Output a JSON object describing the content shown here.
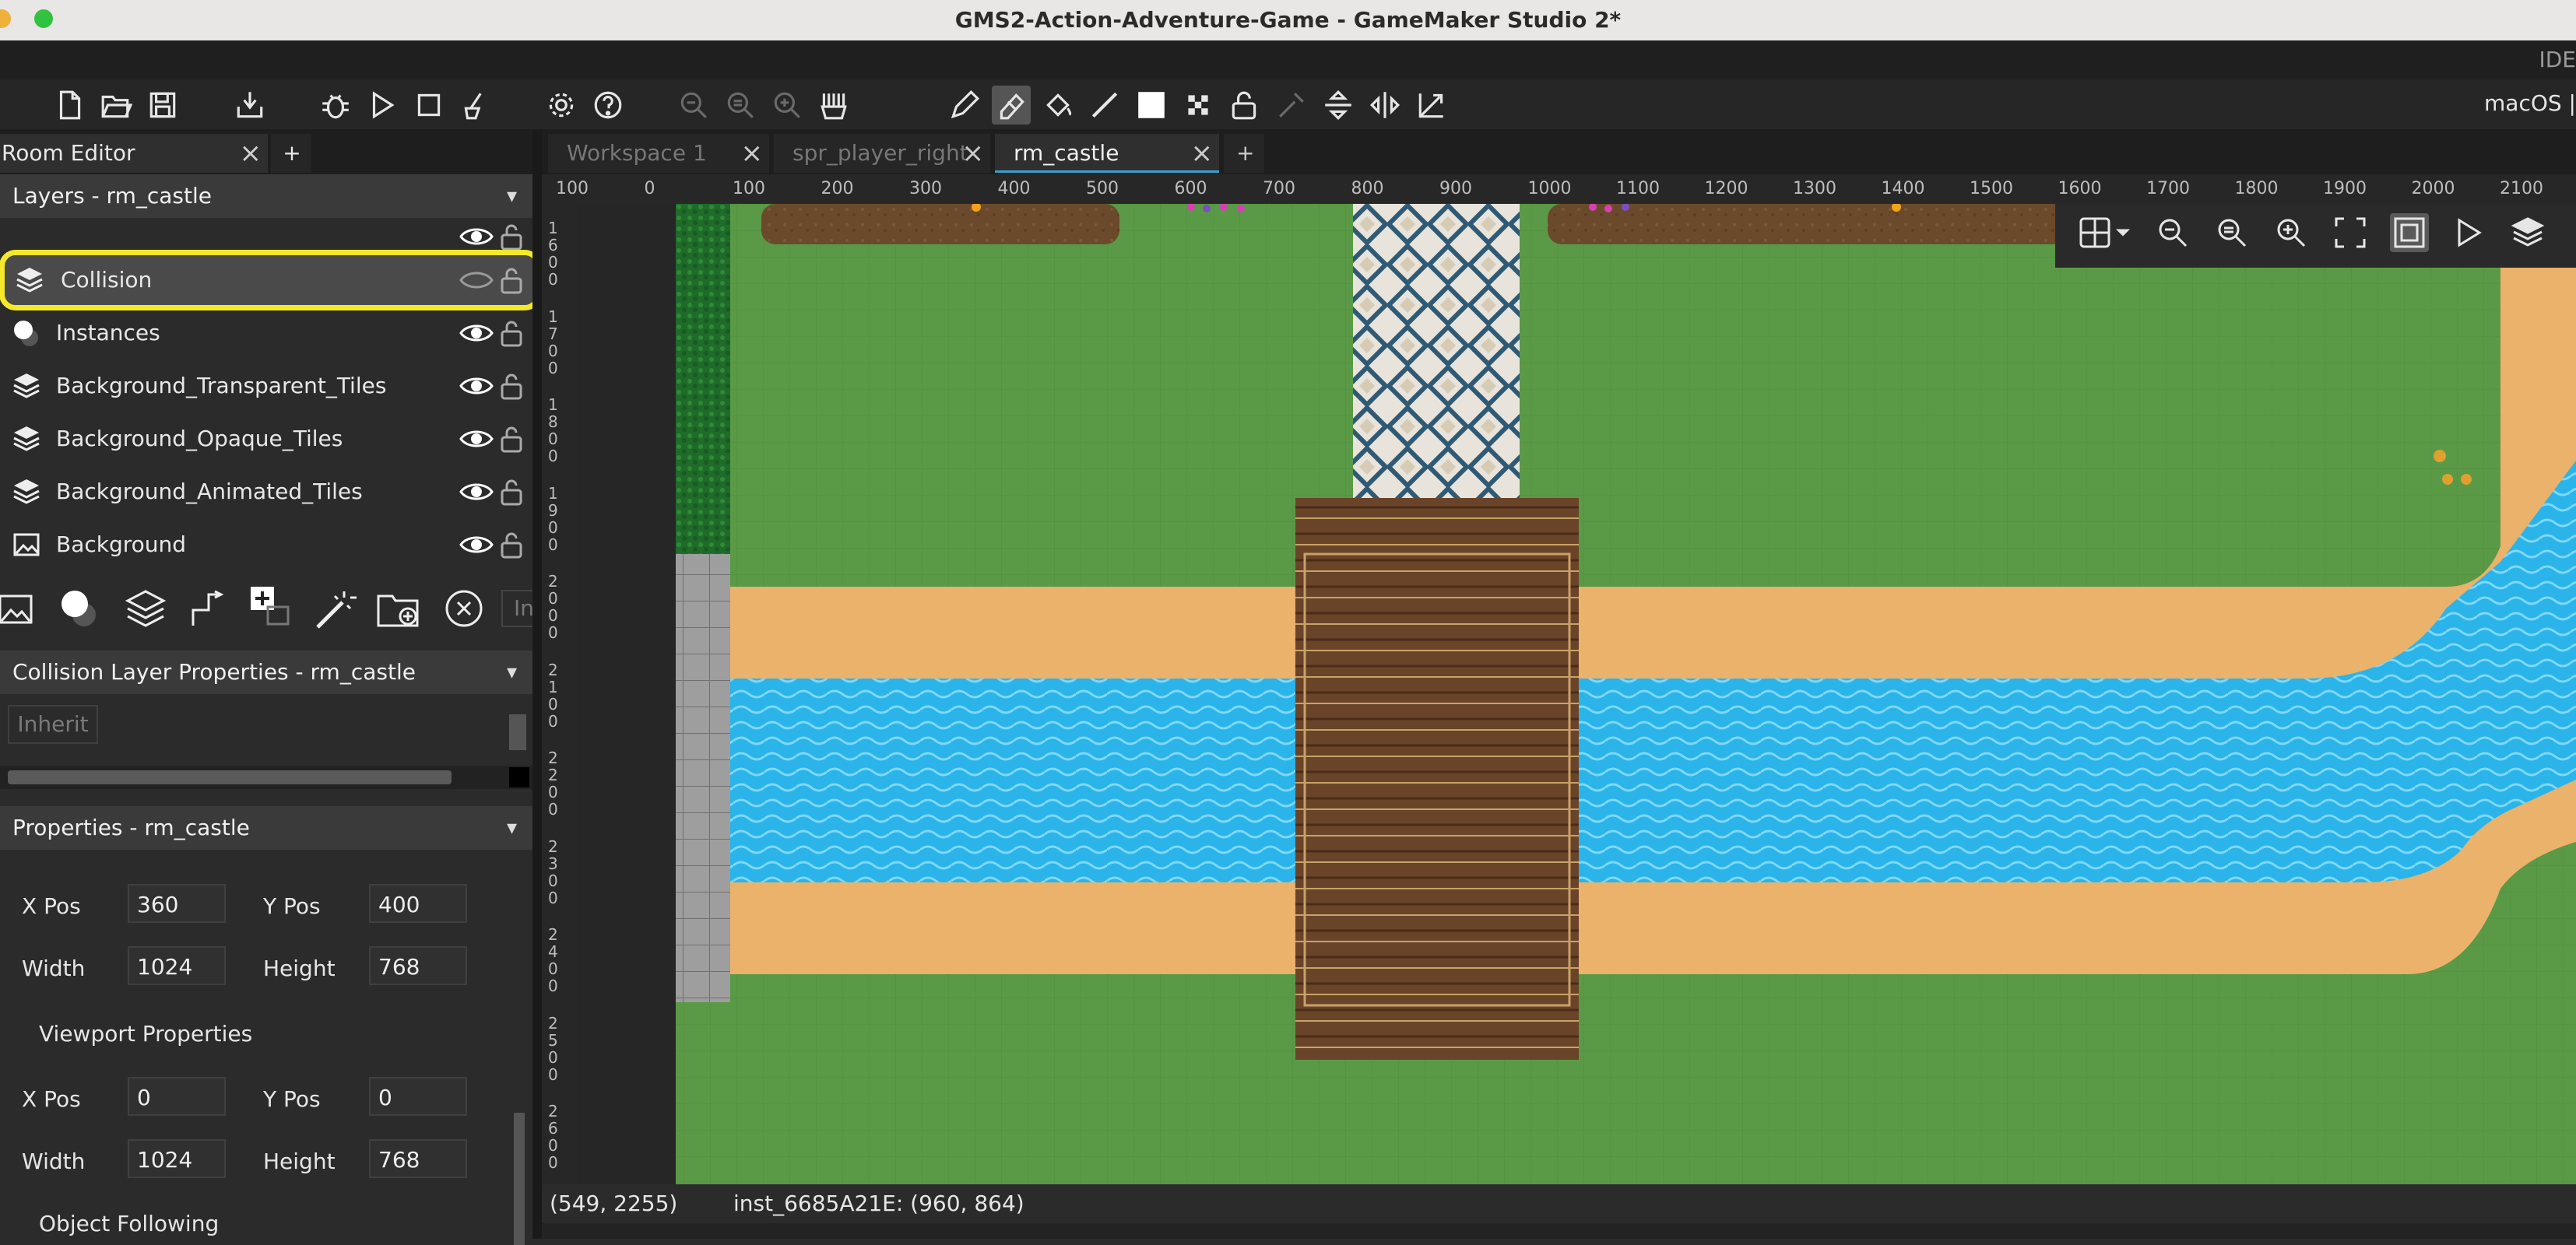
{
  "window": {
    "title": "GMS2-Action-Adventure-Game - GameMaker Studio 2*"
  },
  "topbar": {
    "ide_label": "IDE",
    "target_label": "macOS |"
  },
  "left_tabs": {
    "room_editor": "Room Editor",
    "add": "+"
  },
  "layers_panel": {
    "header": "Layers - rm_castle",
    "layers": [
      {
        "name": "Collision",
        "icon": "tile-layer-icon"
      },
      {
        "name": "Instances",
        "icon": "instance-layer-icon"
      },
      {
        "name": "Background_Transparent_Tiles",
        "icon": "tile-layer-icon"
      },
      {
        "name": "Background_Opaque_Tiles",
        "icon": "tile-layer-icon"
      },
      {
        "name": "Background_Animated_Tiles",
        "icon": "tile-layer-icon"
      },
      {
        "name": "Background",
        "icon": "background-layer-icon"
      }
    ],
    "partial_button_label": "In"
  },
  "collision_panel": {
    "header": "Collision Layer Properties - rm_castle",
    "inherit_label": "Inherit"
  },
  "properties_panel": {
    "header": "Properties - rm_castle",
    "camera": {
      "x_label": "X Pos",
      "x_value": "360",
      "y_label": "Y Pos",
      "y_value": "400",
      "w_label": "Width",
      "w_value": "1024",
      "h_label": "Height",
      "h_value": "768"
    },
    "viewport_label": "Viewport Properties",
    "viewport": {
      "x_label": "X Pos",
      "x_value": "0",
      "y_label": "Y Pos",
      "y_value": "0",
      "w_label": "Width",
      "w_value": "1024",
      "h_label": "Height",
      "h_value": "768"
    },
    "object_following_label": "Object Following"
  },
  "doc_tabs": [
    {
      "label": "Workspace 1"
    },
    {
      "label": "spr_player_right"
    },
    {
      "label": "rm_castle"
    }
  ],
  "doc_tabs_add": "+",
  "ruler": {
    "h_labels": [
      "100",
      "0",
      "100",
      "200",
      "300",
      "400",
      "500",
      "600",
      "700",
      "800",
      "900",
      "1000",
      "1100",
      "1200",
      "1300",
      "1400",
      "1500",
      "1600",
      "1700",
      "1800",
      "1900",
      "2000",
      "2100"
    ],
    "v_labels": [
      "1600",
      "1700",
      "1800",
      "1900",
      "2000",
      "2100",
      "2200",
      "2300",
      "2400",
      "2500",
      "2600"
    ]
  },
  "status": {
    "cursor": "(549, 2255)",
    "instance": "inst_6685A21E: (960, 864)"
  },
  "colors": {
    "highlight": "#f4e82a",
    "grass": "#5a9a46",
    "water": "#29b3e8",
    "sand": "#eab26a",
    "wood": "#6a4428"
  }
}
